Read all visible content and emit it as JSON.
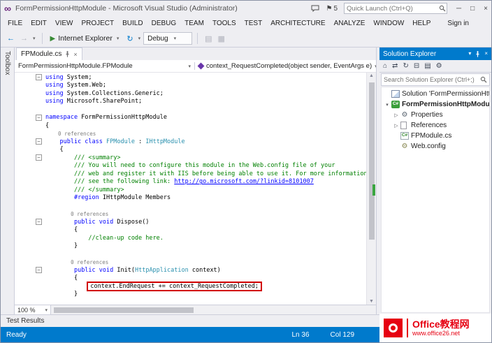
{
  "icons": {
    "vs-logo": "∞",
    "flag": "⚑",
    "minimize": "─",
    "maximize": "□",
    "close": "×",
    "back": "←",
    "forward": "→",
    "caret": "▾",
    "play": "▶",
    "refresh": "↻",
    "tab-close": "×",
    "expander-open": "▾",
    "expander-closed": "▷",
    "scroll-up": "▲",
    "scroll-down": "▼",
    "extra-1": "▤",
    "extra-2": "▦"
  },
  "window": {
    "title": "FormPermissionHttpModule - Microsoft Visual Studio (Administrator)",
    "flag_count": "5",
    "quick_launch_placeholder": "Quick Launch (Ctrl+Q)"
  },
  "menu_bar": {
    "items": [
      "FILE",
      "EDIT",
      "VIEW",
      "PROJECT",
      "BUILD",
      "DEBUG",
      "TEAM",
      "TOOLS",
      "TEST",
      "ARCHITECTURE",
      "ANALYZE",
      "WINDOW",
      "HELP"
    ],
    "sign_in_label": "Sign in"
  },
  "toolbar": {
    "browser_label": "Internet Explorer",
    "config_label": "Debug"
  },
  "toolbox": {
    "label": "Toolbox"
  },
  "editor": {
    "tab_label": "FPModule.cs",
    "breadcrumb_type": "FormPermissionHttpModule.FPModule",
    "breadcrumb_member": "context_RequestCompleted(object sender, EventArgs e)",
    "zoom_level": "100 %",
    "code_lines": [
      {
        "fold": true,
        "seg": [
          [
            "k",
            "using"
          ],
          [
            "p",
            " System;"
          ]
        ]
      },
      {
        "seg": [
          [
            "k",
            "using"
          ],
          [
            "p",
            " System.Web;"
          ]
        ]
      },
      {
        "seg": [
          [
            "k",
            "using"
          ],
          [
            "p",
            " System.Collections.Generic;"
          ]
        ]
      },
      {
        "seg": [
          [
            "k",
            "using"
          ],
          [
            "p",
            " Microsoft.SharePoint;"
          ]
        ]
      },
      {
        "seg": []
      },
      {
        "fold": true,
        "seg": [
          [
            "k",
            "namespace"
          ],
          [
            "p",
            " FormPermissionHttpModule"
          ]
        ]
      },
      {
        "seg": [
          [
            "p",
            "{"
          ]
        ]
      },
      {
        "lens": true,
        "seg": [
          [
            "g",
            "    0 references"
          ]
        ]
      },
      {
        "fold": true,
        "seg": [
          [
            "p",
            "    "
          ],
          [
            "k",
            "public class"
          ],
          [
            "p",
            " "
          ],
          [
            "t",
            "FPModule"
          ],
          [
            "p",
            " : "
          ],
          [
            "t",
            "IHttpModule"
          ]
        ]
      },
      {
        "seg": [
          [
            "p",
            "    {"
          ]
        ]
      },
      {
        "fold": true,
        "seg": [
          [
            "c",
            "        /// <summary>"
          ]
        ]
      },
      {
        "seg": [
          [
            "c",
            "        /// You will need to configure this module in the Web.config file of your"
          ]
        ]
      },
      {
        "seg": [
          [
            "c",
            "        /// web and register it with IIS before being able to use it. For more information"
          ]
        ]
      },
      {
        "seg": [
          [
            "c",
            "        /// see the following link: "
          ],
          [
            "lnk",
            "http://go.microsoft.com/?linkid=8101007"
          ]
        ]
      },
      {
        "seg": [
          [
            "c",
            "        /// </summary>"
          ]
        ]
      },
      {
        "seg": [
          [
            "p",
            "        "
          ],
          [
            "k",
            "#region"
          ],
          [
            "p",
            " IHttpModule Members"
          ]
        ]
      },
      {
        "seg": []
      },
      {
        "lens": true,
        "seg": [
          [
            "g",
            "        0 references"
          ]
        ]
      },
      {
        "fold": true,
        "seg": [
          [
            "p",
            "        "
          ],
          [
            "k",
            "public void"
          ],
          [
            "p",
            " Dispose()"
          ]
        ]
      },
      {
        "seg": [
          [
            "p",
            "        {"
          ]
        ]
      },
      {
        "seg": [
          [
            "c",
            "            //clean-up code here."
          ]
        ]
      },
      {
        "seg": [
          [
            "p",
            "        }"
          ]
        ]
      },
      {
        "seg": []
      },
      {
        "lens": true,
        "seg": [
          [
            "g",
            "        0 references"
          ]
        ]
      },
      {
        "fold": true,
        "seg": [
          [
            "p",
            "        "
          ],
          [
            "k",
            "public void"
          ],
          [
            "p",
            " Init("
          ],
          [
            "t",
            "HttpApplication"
          ],
          [
            "p",
            " context)"
          ]
        ]
      },
      {
        "seg": [
          [
            "p",
            "        {"
          ]
        ]
      },
      {
        "hl": true,
        "pre": "            ",
        "seg": [
          [
            "p",
            "context.EndRequest += context_RequestCompleted;"
          ]
        ]
      },
      {
        "seg": [
          [
            "p",
            "        }"
          ]
        ]
      },
      {
        "seg": []
      }
    ]
  },
  "solution_explorer": {
    "title": "Solution Explorer",
    "search_placeholder": "Search Solution Explorer (Ctrl+;)",
    "toolbar_icons": [
      {
        "name": "home-icon",
        "glyph": "⌂"
      },
      {
        "name": "sync-with-active-document-icon",
        "glyph": "⇄"
      },
      {
        "name": "refresh-icon",
        "glyph": "↻"
      },
      {
        "name": "collapse-all-icon",
        "glyph": "⊟"
      },
      {
        "name": "show-all-files-icon",
        "glyph": "▤"
      },
      {
        "name": "properties-icon",
        "glyph": "⚙"
      }
    ],
    "items": [
      {
        "icon": "solution",
        "label": "Solution 'FormPermissionHttpM",
        "indent": 0,
        "expander": "none"
      },
      {
        "icon": "csproj",
        "label": "FormPermissionHttpModule",
        "indent": 0,
        "expander": "open",
        "bold": true
      },
      {
        "icon": "properties",
        "label": "Properties",
        "indent": 1,
        "expander": "closed"
      },
      {
        "icon": "references",
        "label": "References",
        "indent": 1,
        "expander": "closed"
      },
      {
        "icon": "csfile",
        "label": "FPModule.cs",
        "indent": 1,
        "expander": "none"
      },
      {
        "icon": "config",
        "label": "Web.config",
        "indent": 1,
        "expander": "none"
      }
    ]
  },
  "bottom_panel": {
    "test_results_label": "Test Results"
  },
  "status_bar": {
    "ready": "Ready",
    "line": "Ln 36",
    "column": "Col 129"
  },
  "watermark": {
    "title": "Office教程网",
    "url": "www.office26.net"
  },
  "colors": {
    "accent": "#007acc",
    "highlight_box": "#d10000",
    "keyword": "#0000ff",
    "type": "#2b91af",
    "comment": "#008000",
    "watermark_red": "#e60012"
  }
}
